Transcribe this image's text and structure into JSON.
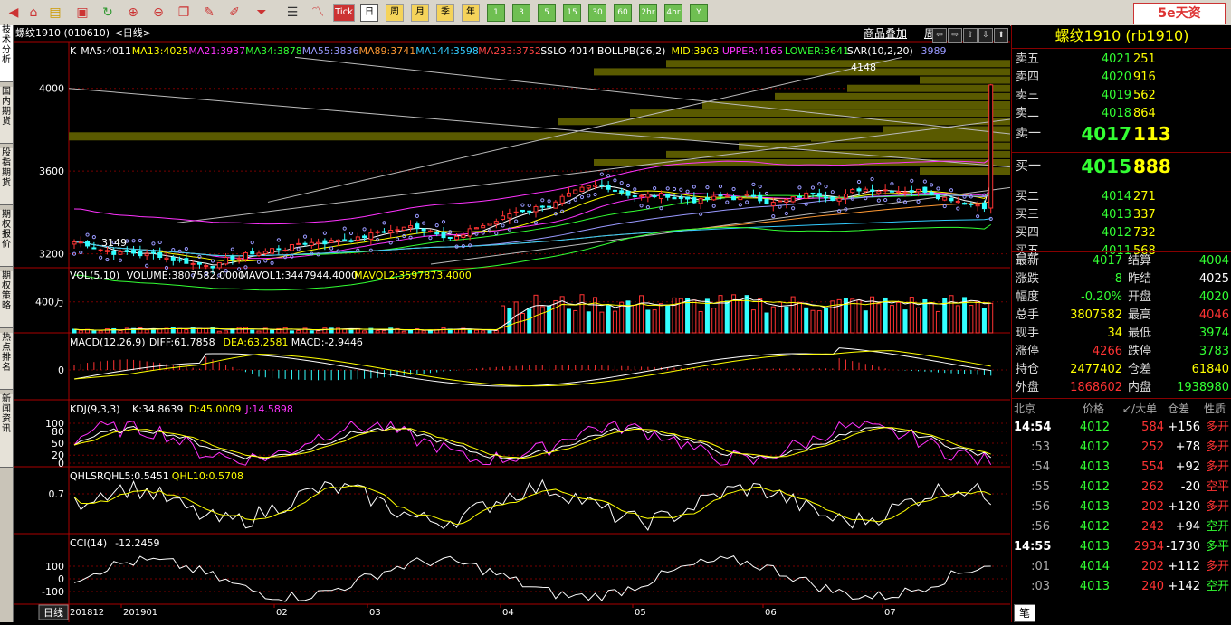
{
  "toolbar": {
    "period_buttons": [
      "日",
      "周",
      "月",
      "季",
      "年",
      "1",
      "3",
      "5",
      "15",
      "30",
      "60",
      "2hr",
      "4hr",
      "Y"
    ],
    "tick_label": "Tick",
    "brand": "5e天资"
  },
  "left_tabs": [
    "技术分析",
    "国内期货",
    "股指期货",
    "期权报价",
    "期权策略",
    "热点排名",
    "新闻资讯"
  ],
  "title": {
    "symbol": "螺纹1910 (010610)",
    "period": "<日线>",
    "link1": "商品叠加",
    "link2": "周期",
    "nav": [
      "⇦",
      "⇨",
      "⇧",
      "⇩",
      "⬆"
    ]
  },
  "indicators": {
    "main": [
      {
        "text": "K",
        "color": "#ffffff"
      },
      {
        "text": "MA5:4011",
        "color": "#ffffff"
      },
      {
        "text": "MA13:4025",
        "color": "#ffff00"
      },
      {
        "text": "MA21:3937",
        "color": "#ff33ff"
      },
      {
        "text": "MA34:3878",
        "color": "#33ff33"
      },
      {
        "text": "MA55:3836",
        "color": "#9999ff"
      },
      {
        "text": "MA89:3741",
        "color": "#ff9933"
      },
      {
        "text": "MA144:3598",
        "color": "#33ccff"
      },
      {
        "text": "MA233:3752",
        "color": "#ff4444"
      },
      {
        "text": "SSLO 4014",
        "color": "#ffffff"
      },
      {
        "text": "BOLLPB(26,2)",
        "color": "#ffffff"
      },
      {
        "text": "MID:3903",
        "color": "#ffff00"
      },
      {
        "text": "UPPER:4165",
        "color": "#ff33ff"
      },
      {
        "text": "LOWER:3641",
        "color": "#33ff33"
      },
      {
        "text": "SAR(10,2,20)",
        "color": "#ffffff"
      },
      {
        "text": "3989",
        "color": "#9999ff"
      }
    ],
    "vol": [
      {
        "text": "VOL(5,10)",
        "color": "#ffffff"
      },
      {
        "text": "VOLUME:3807582.0000",
        "color": "#ffffff"
      },
      {
        "text": "MAVOL1:3447944.4000",
        "color": "#ffffff"
      },
      {
        "text": "MAVOL2:3597873.4000",
        "color": "#ffff00"
      }
    ],
    "macd": [
      {
        "text": "MACD(12,26,9)",
        "color": "#ffffff"
      },
      {
        "text": "DIFF:61.7858",
        "color": "#ffffff"
      },
      {
        "text": "DEA:63.2581",
        "color": "#ffff00"
      },
      {
        "text": "MACD:-2.9446",
        "color": "#ffffff"
      }
    ],
    "kdj": [
      {
        "text": "KDJ(9,3,3)",
        "color": "#ffffff"
      },
      {
        "text": "K:34.8639",
        "color": "#ffffff"
      },
      {
        "text": "D:45.0009",
        "color": "#ffff00"
      },
      {
        "text": "J:14.5898",
        "color": "#ff33ff"
      }
    ],
    "qhlsr": [
      {
        "text": "QHLSR",
        "color": "#ffffff"
      },
      {
        "text": "QHL5:0.5451",
        "color": "#ffffff"
      },
      {
        "text": "QHL10:0.5708",
        "color": "#ffff00"
      }
    ],
    "cci": [
      {
        "text": "CCI(14)",
        "color": "#ffffff"
      },
      {
        "text": "-12.2459",
        "color": "#ffffff"
      }
    ]
  },
  "axis": {
    "price_ticks": [
      "4000",
      "3600",
      "3200"
    ],
    "vol_tick": "400万",
    "macd_tick": "0",
    "kdj_ticks": [
      "100",
      "80",
      "50",
      "20",
      "0"
    ],
    "qhl_tick": "0.7",
    "cci_ticks": [
      "100",
      "0",
      "-100"
    ],
    "high_label": "4148",
    "low_label": "3149",
    "date_labels": [
      "201812",
      "201901",
      "02",
      "03",
      "04",
      "05",
      "06",
      "07"
    ],
    "bottom_label": "日线"
  },
  "quote": {
    "title": "螺纹1910 (rb1910)",
    "asks": [
      {
        "label": "卖五",
        "price": "4021",
        "vol": "251"
      },
      {
        "label": "卖四",
        "price": "4020",
        "vol": "916"
      },
      {
        "label": "卖三",
        "price": "4019",
        "vol": "562"
      },
      {
        "label": "卖二",
        "price": "4018",
        "vol": "864"
      },
      {
        "label": "卖一",
        "price": "4017",
        "vol": "113"
      }
    ],
    "bids": [
      {
        "label": "买一",
        "price": "4015",
        "vol": "888"
      },
      {
        "label": "买二",
        "price": "4014",
        "vol": "271"
      },
      {
        "label": "买三",
        "price": "4013",
        "vol": "337"
      },
      {
        "label": "买四",
        "price": "4012",
        "vol": "732"
      },
      {
        "label": "买五",
        "price": "4011",
        "vol": "568"
      }
    ],
    "stats": [
      {
        "a": "最新",
        "av": "4017",
        "ac": "green",
        "b": "结算",
        "bv": "4004",
        "bc": "green"
      },
      {
        "a": "涨跌",
        "av": "-8",
        "ac": "green",
        "b": "昨结",
        "bv": "4025",
        "bc": "white"
      },
      {
        "a": "幅度",
        "av": "-0.20%",
        "ac": "green",
        "b": "开盘",
        "bv": "4020",
        "bc": "green"
      },
      {
        "a": "总手",
        "av": "3807582",
        "ac": "yellow",
        "b": "最高",
        "bv": "4046",
        "bc": "red"
      },
      {
        "a": "现手",
        "av": "34",
        "ac": "yellow",
        "b": "最低",
        "bv": "3974",
        "bc": "green"
      },
      {
        "a": "涨停",
        "av": "4266",
        "ac": "red",
        "b": "跌停",
        "bv": "3783",
        "bc": "green"
      },
      {
        "a": "持仓",
        "av": "2477402",
        "ac": "yellow",
        "b": "仓差",
        "bv": "61840",
        "bc": "yellow"
      },
      {
        "a": "外盘",
        "av": "1868602",
        "ac": "red",
        "b": "内盘",
        "bv": "1938980",
        "bc": "green"
      }
    ],
    "tick_header": [
      "北京",
      "价格",
      "↙/大单",
      "仓差",
      "性质"
    ],
    "ticks": [
      {
        "t": "14:54",
        "p": "4012",
        "v": "584",
        "d": "+156",
        "n": "多开",
        "nc": "red"
      },
      {
        "t": ":53",
        "p": "4012",
        "v": "252",
        "d": "+78",
        "n": "多开",
        "nc": "red"
      },
      {
        "t": ":54",
        "p": "4013",
        "v": "554",
        "d": "+92",
        "n": "多开",
        "nc": "red"
      },
      {
        "t": ":55",
        "p": "4012",
        "v": "262",
        "d": "-20",
        "n": "空平",
        "nc": "red"
      },
      {
        "t": ":56",
        "p": "4013",
        "v": "202",
        "d": "+120",
        "n": "多开",
        "nc": "red"
      },
      {
        "t": ":56",
        "p": "4012",
        "v": "242",
        "d": "+94",
        "n": "空开",
        "nc": "green"
      },
      {
        "t": "14:55",
        "p": "4013",
        "v": "2934",
        "d": "-1730",
        "n": "多平",
        "nc": "green"
      },
      {
        "t": ":01",
        "p": "4014",
        "v": "202",
        "d": "+112",
        "n": "多开",
        "nc": "red"
      },
      {
        "t": ":03",
        "p": "4013",
        "v": "240",
        "d": "+142",
        "n": "空开",
        "nc": "green"
      }
    ],
    "bottom_tab": "笔"
  }
}
